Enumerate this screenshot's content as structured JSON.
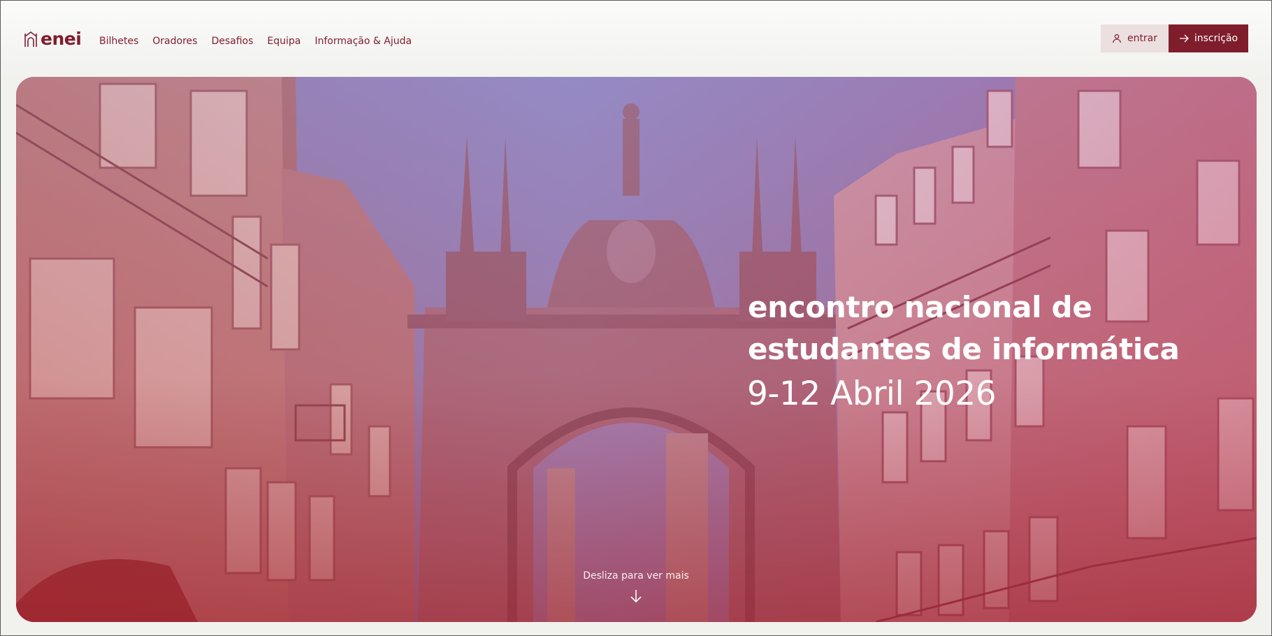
{
  "brand": {
    "logo_text": "enei",
    "color": "#7f1d2d"
  },
  "nav": {
    "items": [
      {
        "label": "Bilhetes"
      },
      {
        "label": "Oradores"
      },
      {
        "label": "Desafios"
      },
      {
        "label": "Equipa"
      },
      {
        "label": "Informação & Ajuda"
      }
    ]
  },
  "header": {
    "login_label": "entrar",
    "login_icon": "user-icon",
    "register_label": "inscrição",
    "register_icon": "arrow-right-icon"
  },
  "hero": {
    "title_line1": "encontro nacional de",
    "title_line2": "estudantes de informática",
    "date": "9-12 Abril 2026",
    "scroll_hint": "Desliza para ver mais",
    "scroll_icon": "arrow-down-icon",
    "image": "city-arch-photo"
  },
  "colors": {
    "accent": "#7f1d2d",
    "login_bg": "#ecdfe0",
    "page_bg": "#f1f1ee"
  }
}
